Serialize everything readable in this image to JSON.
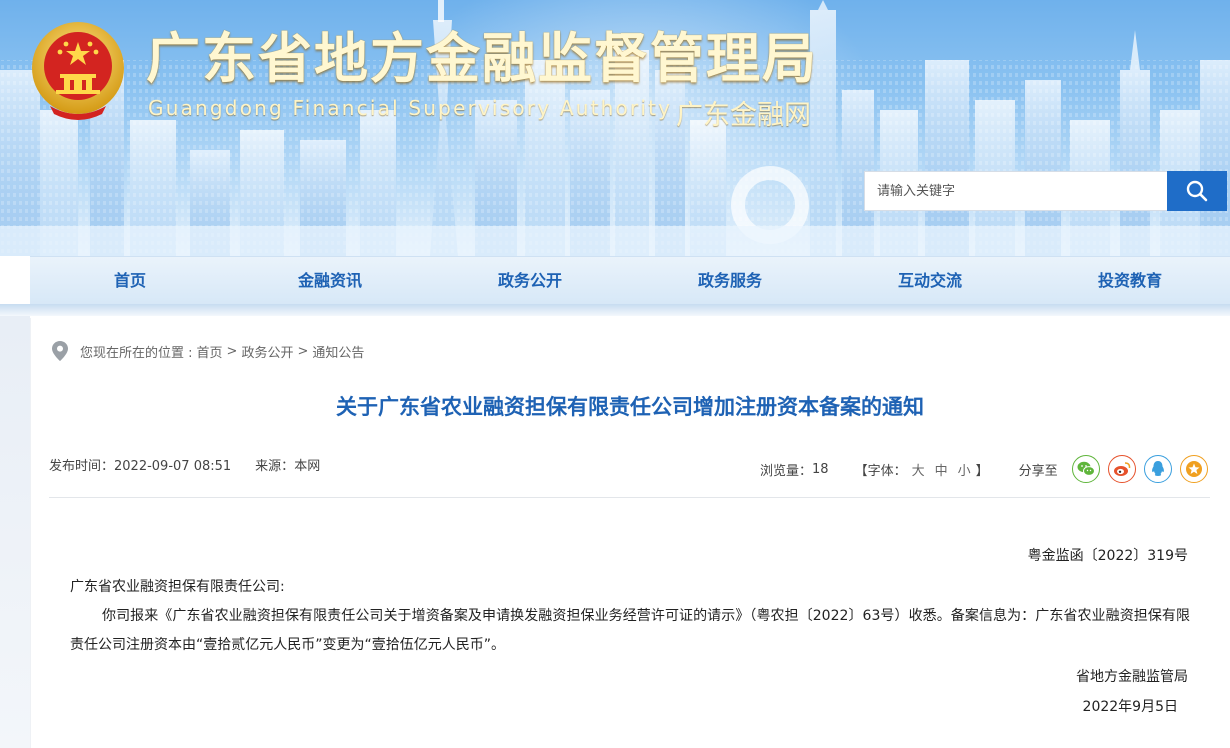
{
  "header": {
    "title_cn": "广东省地方金融监督管理局",
    "title_en": "Guangdong Financial Supervisory Authority",
    "site_name": "广东金融网",
    "search": {
      "placeholder": "请输入关键字"
    }
  },
  "nav": {
    "items": [
      {
        "label": "首页"
      },
      {
        "label": "金融资讯"
      },
      {
        "label": "政务公开"
      },
      {
        "label": "政务服务"
      },
      {
        "label": "互动交流"
      },
      {
        "label": "投资教育"
      }
    ]
  },
  "breadcrumb": {
    "prefix": "您现在所在的位置 :",
    "items": [
      "首页",
      "政务公开",
      "通知公告"
    ],
    "separator": ">"
  },
  "article": {
    "title": "关于广东省农业融资担保有限责任公司增加注册资本备案的通知",
    "publish_label": "发布时间：",
    "publish_time": "2022-09-07 08:51",
    "source_label": "来源：",
    "source": "本网",
    "views_label": "浏览量：",
    "views": "18",
    "font_label_open": "【字体：",
    "font_large": "大",
    "font_medium": "中",
    "font_small": "小",
    "font_label_close": "】",
    "share_label": "分享至",
    "doc_number": "粤金监函〔2022〕319号",
    "addressee": "广东省农业融资担保有限责任公司:",
    "body": "你司报来《广东省农业融资担保有限责任公司关于增资备案及申请换发融资担保业务经营许可证的请示》（粤农担〔2022〕63号）收悉。备案信息为：广东省农业融资担保有限责任公司注册资本由“壹拾贰亿元人民币”变更为“壹拾伍亿元人民币”。",
    "signer": "省地方金融监管局",
    "sign_date": "2022年9月5日"
  },
  "colors": {
    "brand_blue": "#1e62b4",
    "search_button": "#1f6dc8",
    "title_gold": "#fff7d1"
  },
  "icons": {
    "search": "magnifier-icon",
    "location": "location-pin-icon",
    "share": [
      "wechat-icon",
      "weibo-icon",
      "qq-icon",
      "favorite-star-icon"
    ]
  }
}
